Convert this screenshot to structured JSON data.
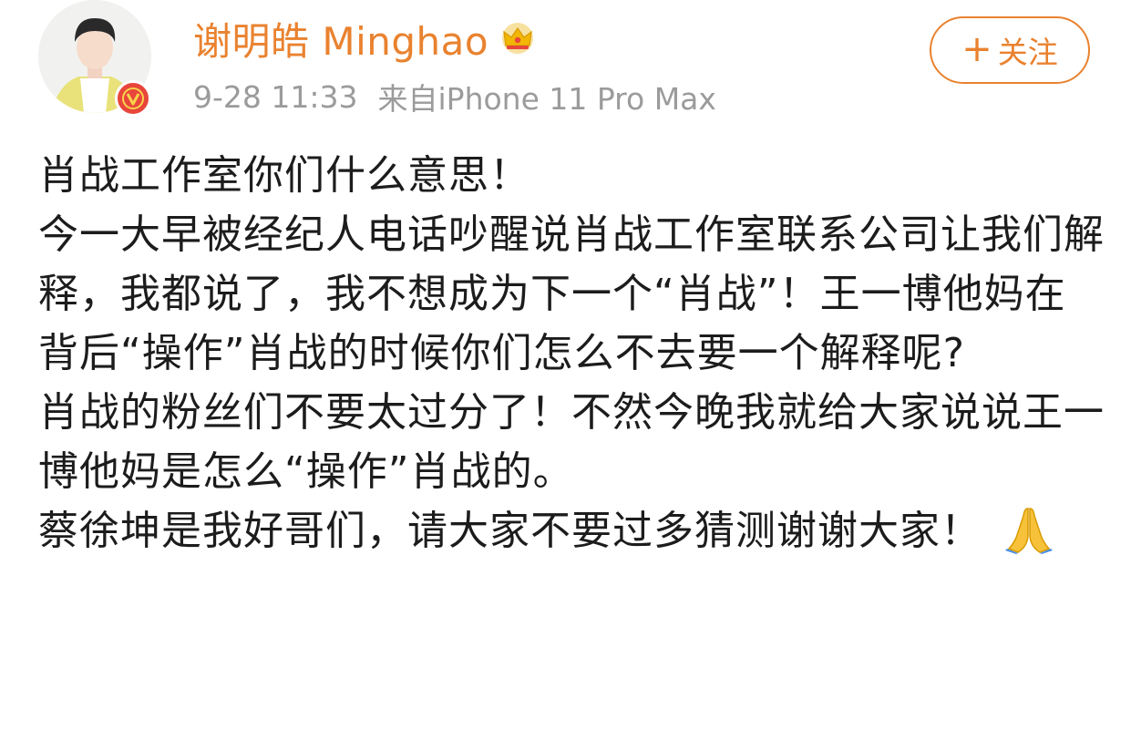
{
  "user": {
    "name": "谢明皓 Minghao",
    "badge_icon": "crown-icon",
    "verified_icon": "verified-v-icon"
  },
  "meta": {
    "time": "9-28 11:33",
    "source": "来自iPhone 11 Pro Max"
  },
  "follow_button": {
    "plus": "+",
    "label": "关注"
  },
  "post": {
    "paragraphs": [
      "肖战工作室你们什么意思！",
      "今一大早被经纪人电话吵醒说肖战工作室联系公司让我们解释，我都说了，我不想成为下一个“肖战”！王一博他妈在背后“操作”肖战的时候你们怎么不去要一个解释呢?",
      "肖战的粉丝们不要太过分了！不然今晚我就给大家说说王一博他妈是怎么“操作”肖战的。",
      "蔡徐坤是我好哥们，请大家不要过多猜测谢谢大家！"
    ],
    "emoji": "folded-hands-icon"
  },
  "colors": {
    "accent": "#e9822f",
    "meta_text": "#9b9b9b",
    "verified": "#e8463b",
    "crown": "#f2b705"
  }
}
